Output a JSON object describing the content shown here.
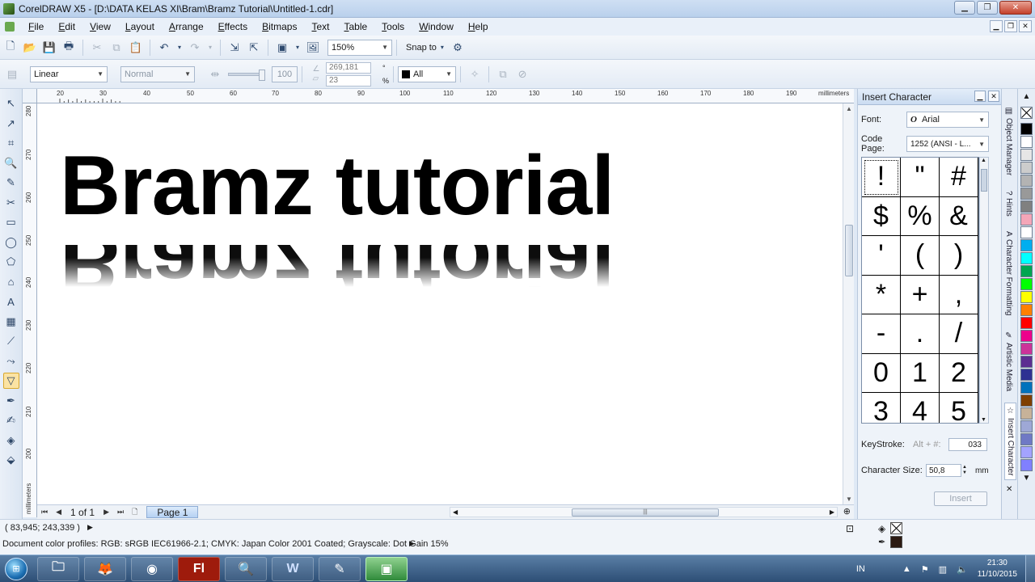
{
  "window": {
    "title": "CorelDRAW X5 - [D:\\DATA KELAS XI\\Bram\\Bramz Tutorial\\Untitled-1.cdr]",
    "controls": [
      "minimize",
      "restore",
      "close"
    ]
  },
  "menu": {
    "items": [
      "File",
      "Edit",
      "View",
      "Layout",
      "Arrange",
      "Effects",
      "Bitmaps",
      "Text",
      "Table",
      "Tools",
      "Window",
      "Help"
    ]
  },
  "standard_toolbar": {
    "zoom_value": "150%",
    "snap_label": "Snap to"
  },
  "property_bar": {
    "transparency_type": "Linear",
    "merge_mode": "Normal",
    "transparency_value": "100",
    "angle_value": "269,181",
    "edge_pad_value": "23",
    "percent_symbol": "%",
    "degree_symbol": "°",
    "apply_to": "All"
  },
  "rulers": {
    "unit": "millimeters",
    "top_ticks": [
      "20",
      "30",
      "40",
      "50",
      "60",
      "70",
      "80",
      "90",
      "100",
      "110",
      "120",
      "130",
      "140",
      "150",
      "160",
      "170",
      "180",
      "190"
    ],
    "left_ticks": [
      "280",
      "270",
      "260",
      "250",
      "240",
      "230",
      "220",
      "210",
      "200"
    ]
  },
  "canvas": {
    "artistic_text": "Bramz tutorial",
    "text_color": "#000000",
    "background": "#ffffff"
  },
  "page_nav": {
    "count": "1 of 1",
    "page_tab": "Page 1"
  },
  "docker": {
    "title": "Insert Character",
    "font_label": "Font:",
    "font_value": "Arial",
    "codepage_label": "Code Page:",
    "codepage_value": "1252  (ANSI - L...",
    "characters": [
      "!",
      "\"",
      "#",
      "$",
      "%",
      "&",
      "'",
      "(",
      ")",
      "*",
      "+",
      ",",
      "-",
      ".",
      "/",
      "0",
      "1",
      "2",
      "3",
      "4",
      "5"
    ],
    "keystroke_label": "KeyStroke:",
    "keystroke_hint": "Alt + #:",
    "keystroke_value": "033",
    "size_label": "Character Size:",
    "size_value": "50,8",
    "size_unit": "mm",
    "insert_label": "Insert"
  },
  "side_tabs": [
    "Object Manager",
    "Hints",
    "Character Formatting",
    "Artistic Media",
    "Insert Character"
  ],
  "palette": [
    "#000000",
    "#ffffff",
    "#e6e6e6",
    "#cccccc",
    "#b3b3b3",
    "#999999",
    "#808080",
    "#f4a6b8",
    "#ffffff",
    "#00aeef",
    "#00ffff",
    "#00a651",
    "#00ff00",
    "#ffff00",
    "#ff8000",
    "#ff0000",
    "#ec008c",
    "#cc3399",
    "#5c2e91",
    "#2e3192",
    "#0072bc",
    "#7f3f00",
    "#c7b299",
    "#9ea8d6",
    "#6f79c5",
    "#a3a3ff",
    "#8080ff"
  ],
  "status": {
    "coordinates": "( 83,945; 243,339 )",
    "color_profiles": "Document color profiles: RGB: sRGB IEC61966-2.1; CMYK: Japan Color 2001 Coated; Grayscale: Dot Gain 15%",
    "fill_color": "none",
    "outline_color": "#2b1a12"
  },
  "taskbar": {
    "apps": [
      "Windows Explorer",
      "Firefox",
      "Chrome",
      "Flash",
      "Image viewer",
      "Word",
      "CorelDRAW",
      "Camtasia"
    ],
    "language": "IN",
    "time": "21:30",
    "date": "11/10/2015"
  }
}
